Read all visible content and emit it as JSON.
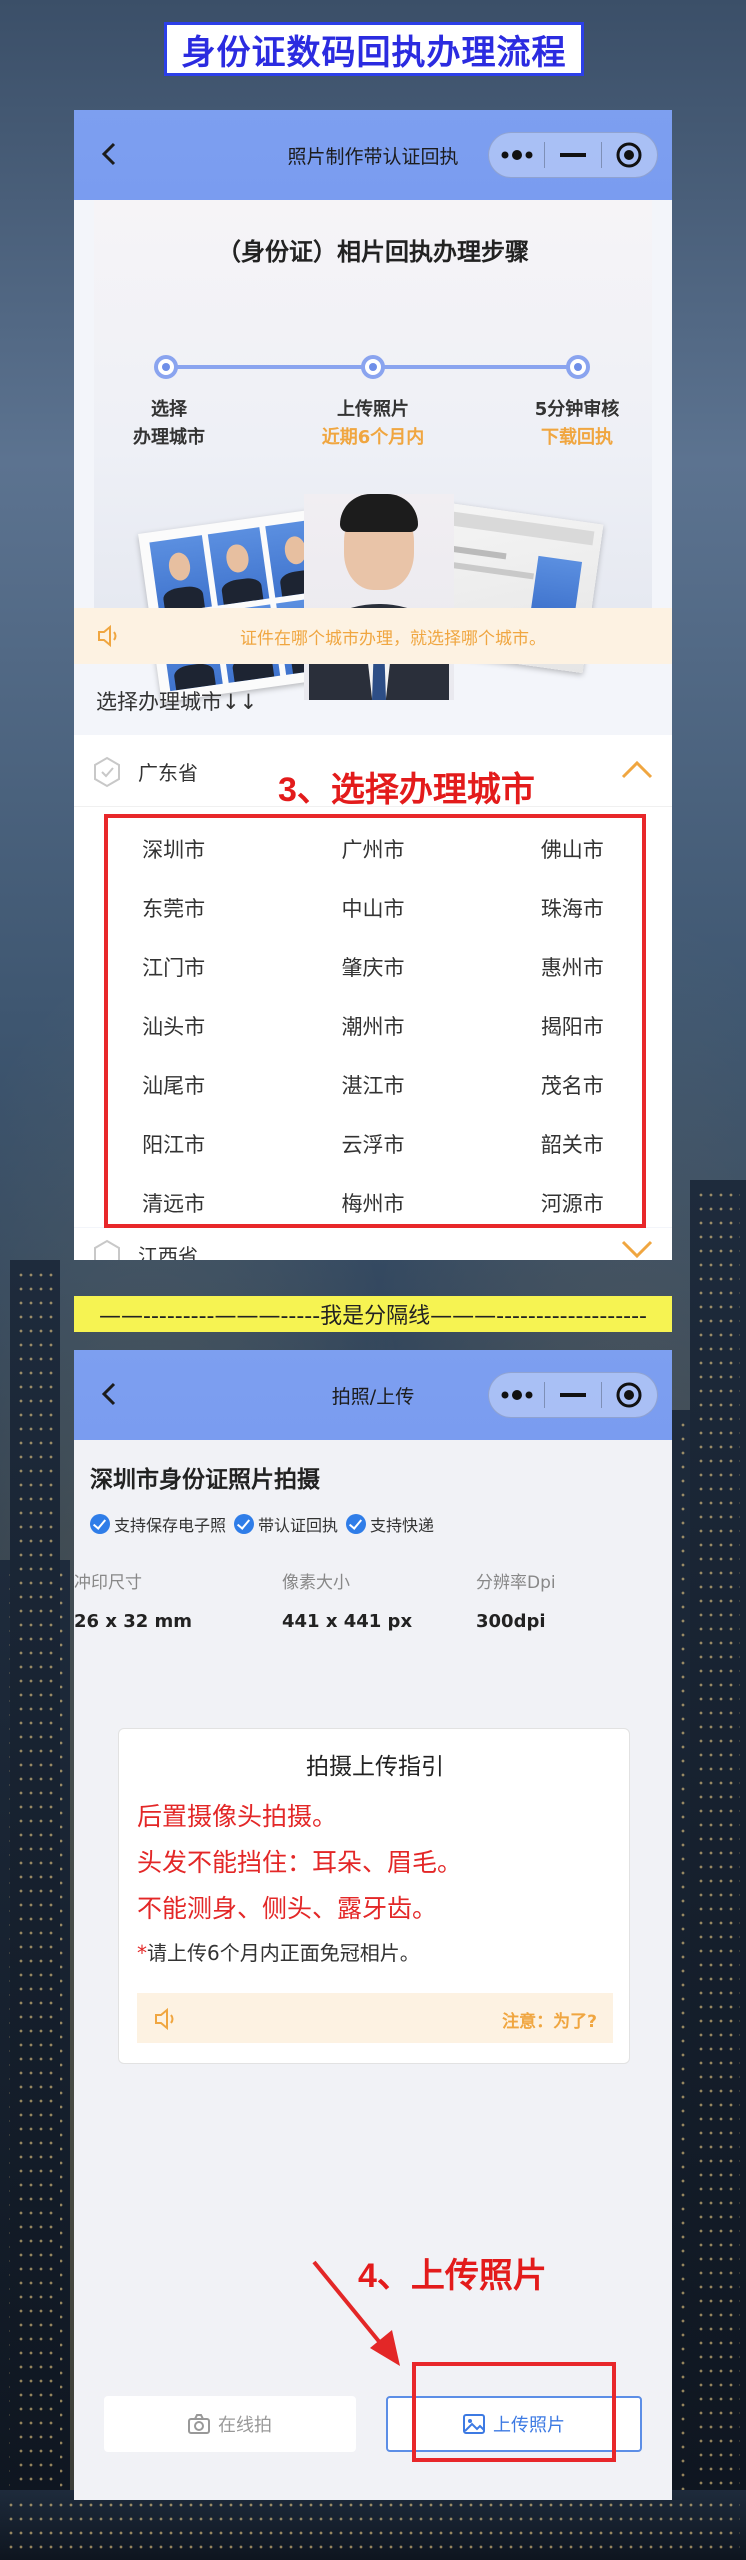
{
  "header": {
    "title": "身份证数码回执办理流程"
  },
  "phone1": {
    "nav_title": "照片制作带认证回执",
    "steps": {
      "title": "（身份证）相片回执办理步骤",
      "items": [
        {
          "line1": "选择",
          "line2": "办理城市",
          "line2_color": "#333333"
        },
        {
          "line1": "上传照片",
          "line2": "近期6个月内",
          "line2_color": "#f0a640"
        },
        {
          "line1": "5分钟审核",
          "line2": "下载回执",
          "line2_color": "#f0a640"
        }
      ]
    },
    "notice": "证件在哪个城市办理，就选择哪个城市。",
    "section_title": "选择办理城市↓↓",
    "province": "广东省",
    "cities": [
      "深圳市",
      "广州市",
      "佛山市",
      "东莞市",
      "中山市",
      "珠海市",
      "江门市",
      "肇庆市",
      "惠州市",
      "汕头市",
      "潮州市",
      "揭阳市",
      "汕尾市",
      "湛江市",
      "茂名市",
      "阳江市",
      "云浮市",
      "韶关市",
      "清远市",
      "梅州市",
      "河源市"
    ],
    "next_province": "江西省",
    "annotation": "3、选择办理城市"
  },
  "divider": "——---------———-----我是分隔线———-------------------",
  "phone2": {
    "nav_title": "拍照/上传",
    "title": "深圳市身份证照片拍摄",
    "tags": [
      "支持保存电子照",
      "带认证回执",
      "支持快递"
    ],
    "specs": [
      {
        "label": "冲印尺寸",
        "value": "26 x 32 mm"
      },
      {
        "label": "像素大小",
        "value": "441 x 441 px"
      },
      {
        "label": "分辨率Dpi",
        "value": "300dpi"
      }
    ],
    "guide": {
      "title": "拍摄上传指引",
      "lines": [
        "后置摄像头拍摄。",
        "头发不能挡住：耳朵、眉毛。",
        "不能测身、侧头、露牙齿。"
      ],
      "note_star": "*",
      "note": "请上传6个月内正面免冠相片。",
      "warning": "注意：为了?"
    },
    "buttons": {
      "online": "在线拍",
      "upload": "上传照片"
    },
    "annotation": "4、上传照片"
  },
  "colors": {
    "nav": "#7a9cf0",
    "accent_red": "#e31b1b",
    "orange": "#f0a640",
    "blue": "#3d7ae3",
    "title_blue": "#2b2be0"
  },
  "icons": [
    "back-arrow-icon",
    "more-dots-icon",
    "minimize-icon",
    "target-circle-icon",
    "speaker-icon",
    "location-icon",
    "chevron-up-icon",
    "chevron-down-icon",
    "check-circle-icon",
    "camera-icon",
    "image-icon"
  ]
}
